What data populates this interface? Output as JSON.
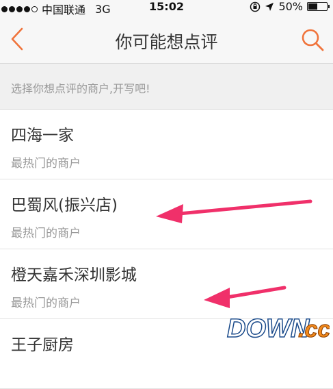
{
  "status_bar": {
    "carrier": "中国联通",
    "network": "3G",
    "time": "15:02",
    "battery_pct": "50%",
    "battery_level": 0.5
  },
  "nav": {
    "title": "你可能想点评",
    "back_icon": "chevron-left-icon",
    "search_icon": "search-icon",
    "accent_color": "#f0743c"
  },
  "hint": {
    "text": "选择你想点评的商户,开写吧!"
  },
  "shops": [
    {
      "name": "四海一家",
      "subtitle": "最热门的商户"
    },
    {
      "name": "巴蜀风(振兴店)",
      "subtitle": "最热门的商户"
    },
    {
      "name": "橙天嘉禾深圳影城",
      "subtitle": "最热门的商户"
    },
    {
      "name": "王子厨房",
      "subtitle": ""
    }
  ],
  "annotation_color": "#f0306a",
  "watermark": {
    "text_main": "DOWN",
    "text_suffix": ".cc"
  }
}
